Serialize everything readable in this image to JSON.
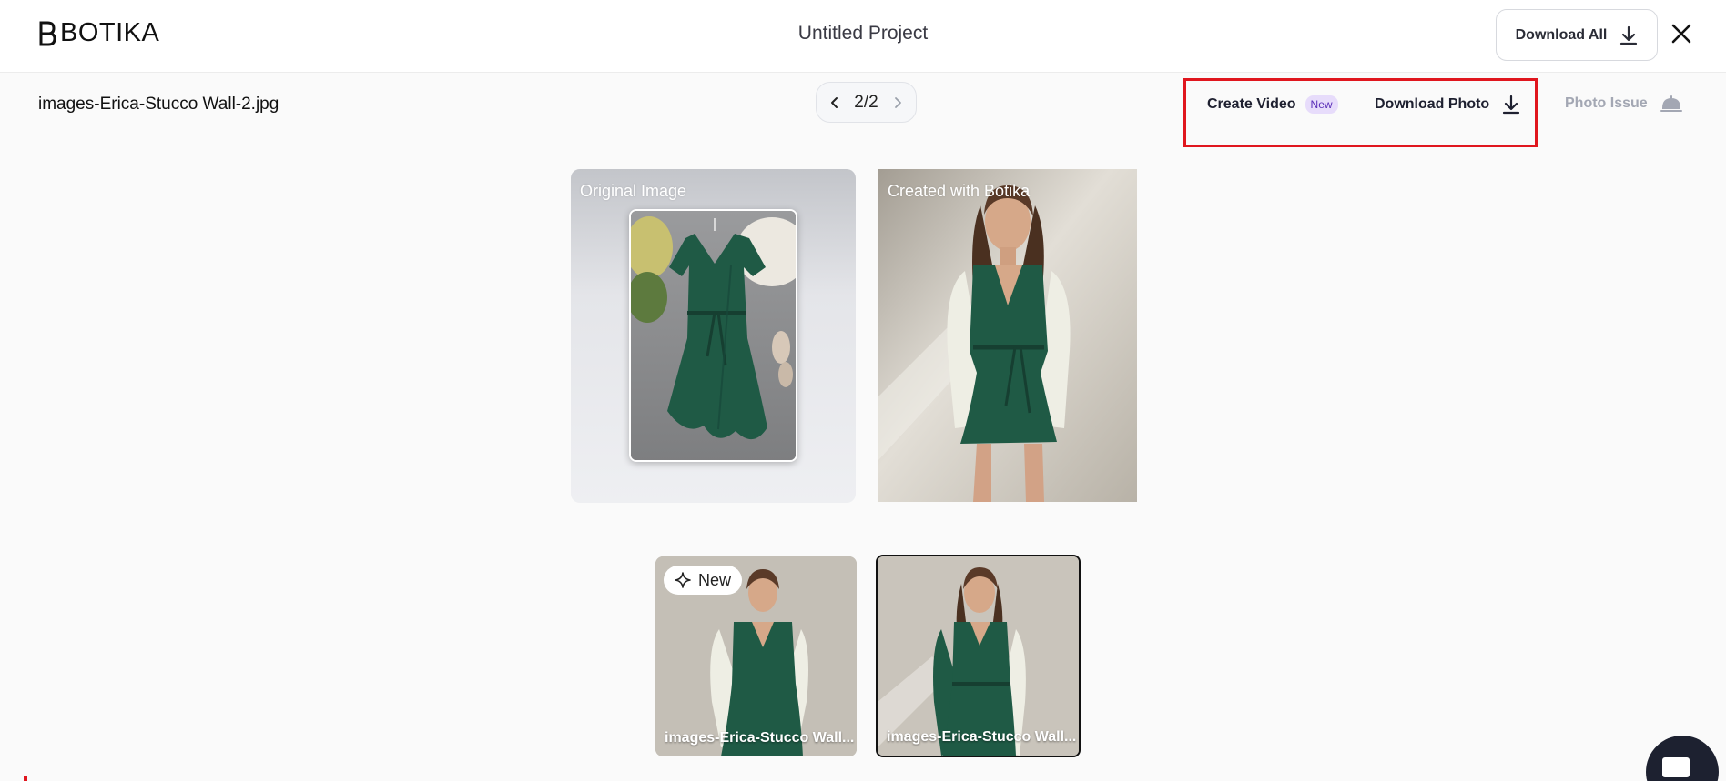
{
  "header": {
    "logo_text": "BOTIKA",
    "project_title": "Untitled Project",
    "download_all_label": "Download All",
    "close_icon": "close-icon"
  },
  "toolbar": {
    "file_name": "images-Erica-Stucco Wall-2.jpg",
    "pager": {
      "current": "2/2"
    },
    "create_video_label": "Create Video",
    "create_video_badge": "New",
    "download_photo_label": "Download Photo",
    "photo_issue_label": "Photo Issue"
  },
  "panels": {
    "original_label": "Original Image",
    "created_label": "Created with Botika"
  },
  "thumbnails": [
    {
      "caption": "images-Erica-Stucco Wall...",
      "badge": "New",
      "selected": false
    },
    {
      "caption": "images-Erica-Stucco Wall...",
      "selected": true
    }
  ],
  "colors": {
    "highlight": "#e0161e",
    "badge_bg": "#e7dcfb",
    "badge_text": "#5a2fb8",
    "dress": "#1f5a45"
  }
}
